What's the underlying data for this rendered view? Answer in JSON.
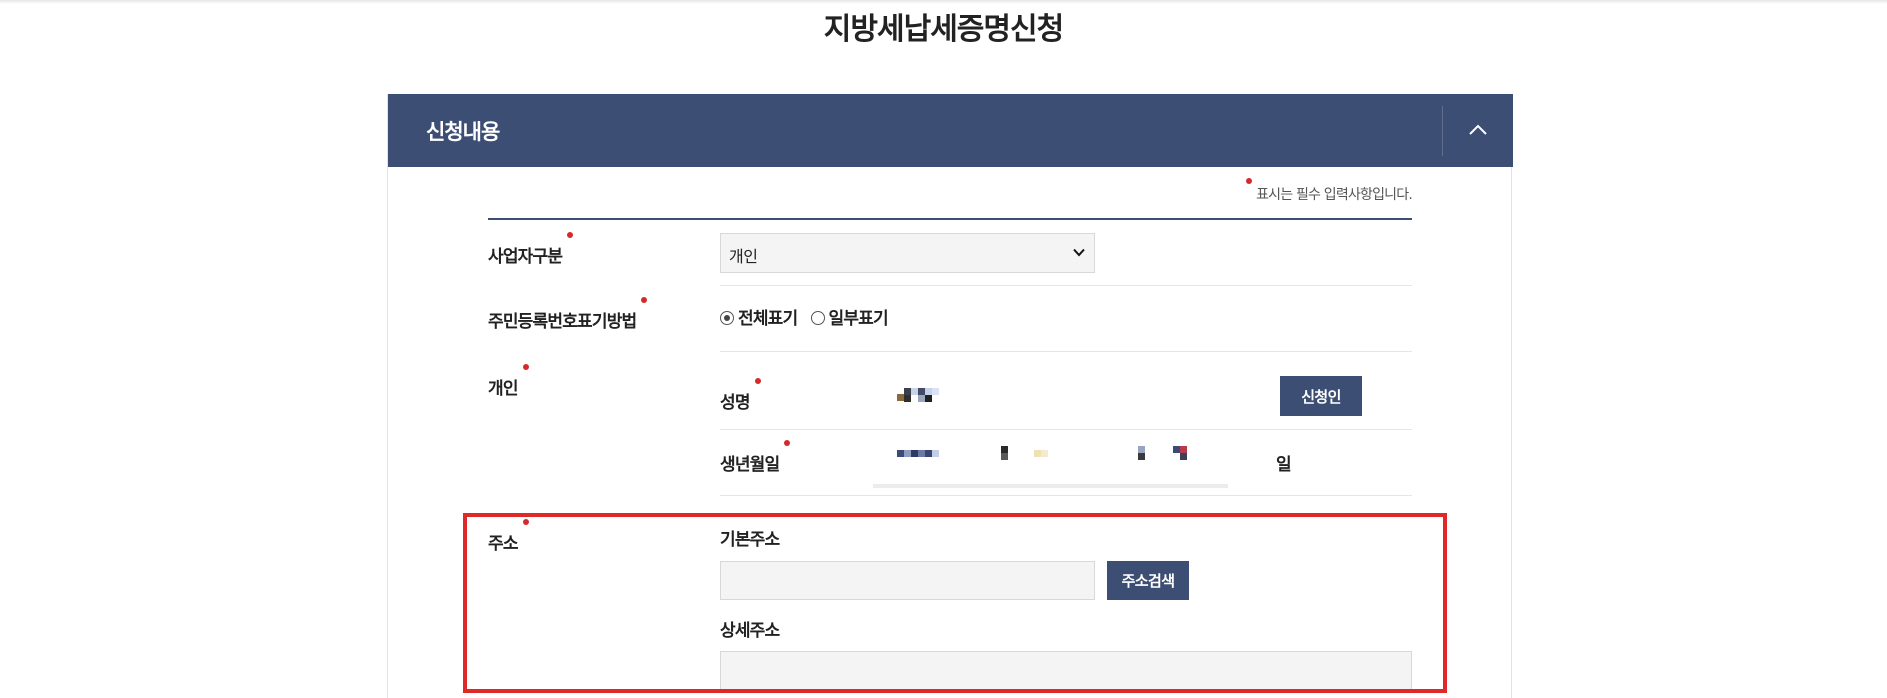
{
  "page": {
    "title": "지방세납세증명신청"
  },
  "panel": {
    "title": "신청내용",
    "collapse_icon": "chevron-up-icon"
  },
  "form": {
    "required_note": "표시는 필수 입력사항입니다.",
    "business_type": {
      "label": "사업자구분",
      "selected": "개인"
    },
    "rrn_display": {
      "label": "주민등록번호표기방법",
      "options": [
        {
          "label": "전체표기",
          "checked": true
        },
        {
          "label": "일부표기",
          "checked": false
        }
      ]
    },
    "individual": {
      "label": "개인",
      "name_label": "성명",
      "applicant_button": "신청인",
      "birth_label": "생년월일",
      "day_suffix": "일"
    },
    "address": {
      "label": "주소",
      "basic_label": "기본주소",
      "search_button": "주소검색",
      "detail_label": "상세주소"
    }
  },
  "colors": {
    "header_bg": "#3d4e74",
    "required_dot": "#d62a2a",
    "highlight": "#e02828"
  }
}
